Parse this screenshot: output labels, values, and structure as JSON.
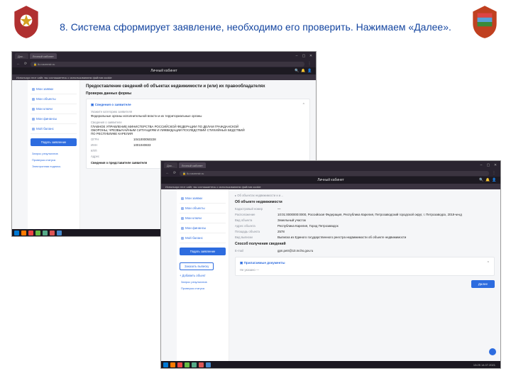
{
  "caption": "8. Система сформирует заявление, необходимо его проверить. Нажимаем «Далее».",
  "browser": {
    "tab1": "Док…",
    "tab2": "Личный кабинет",
    "address": "lk.rosreestr.ru",
    "page_title": "Личный кабинет",
    "cookies": "Используя этот сайт, вы соглашаетесь с использованием файлов cookie"
  },
  "sidebar": {
    "items": [
      "Мои заявки",
      "Мои объекты",
      "Мои ключи",
      "Мои финансы",
      "Мой баланс"
    ],
    "button": "Подать заявление",
    "links": [
      "Запрос результатов",
      "Проверка статуса",
      "Электронная подпись"
    ]
  },
  "screenA": {
    "title": "Предоставление сведений об объектах недвижимости и (или) их правообладателях",
    "section": "Проверка данных формы",
    "card1_head": "Сведения о заявителе",
    "cat_label": "Укажите категорию заявителя",
    "cat_value": "Федеральные органы исполнительной власти и их территориальные органы",
    "org_label": "Сведения о заявителе",
    "org_value": "ГЛАВНОЕ УПРАВЛЕНИЕ МИНИСТЕРСТВА РОССИЙСКОЙ ФЕДЕРАЦИИ ПО ДЕЛАМ ГРАЖДАНСКОЙ ОБОРОНЫ, ЧРЕЗВЫЧАЙНЫМ СИТУАЦИЯМ И ЛИКВИДАЦИИ ПОСЛЕДСТВИЙ СТИХИЙНЫХ БЕДСТВИЙ ПО РЕСПУБЛИКЕ КАРЕЛИЯ",
    "ogrn_k": "ОГРН",
    "ogrn_v": "1041000050228",
    "inn_k": "ИНН",
    "inn_v": "1001040833",
    "kpp_k": "КПП",
    "kpp_v": "",
    "addr_k": "Адрес",
    "addr_v": "",
    "rep_head": "Сведения о представителе заявителя"
  },
  "screenB": {
    "side_extra": "Заказать выписку",
    "side_extra2": "Добавить объект",
    "crumb": "Об объектах недвижимости и и…",
    "section": "Об объекте недвижимости",
    "kn_k": "Кадастровый номер",
    "kn_v": "—",
    "loc_k": "Расположение",
    "loc_v": "10:01:0000000:0000, Российская Федерация, Республика Карелия, Петрозаводский городской округ, г. Петрозаводск, 2019-м-кд",
    "type_k": "Вид объекта",
    "type_v": "Земельный участок",
    "addr_k": "Адрес объекта",
    "addr_v": "Республика Карелия, Город Петрозаводск",
    "area_k": "Площадь объекта",
    "area_v": "2578",
    "doc_k": "Вид выписки",
    "doc_v": "Выписка из Единого государственного реестра недвижимости об объекте недвижимости",
    "delivery": "Способ получения сведений",
    "email_k": "E-mail",
    "email_v": "gpn.petr@10.mchs.gov.ru",
    "docs_card": "Прилагаемые документы",
    "docs_note": "Не указано —",
    "next": "Далее"
  },
  "taskbar": {
    "clock": "13:25  14.07.2021"
  }
}
